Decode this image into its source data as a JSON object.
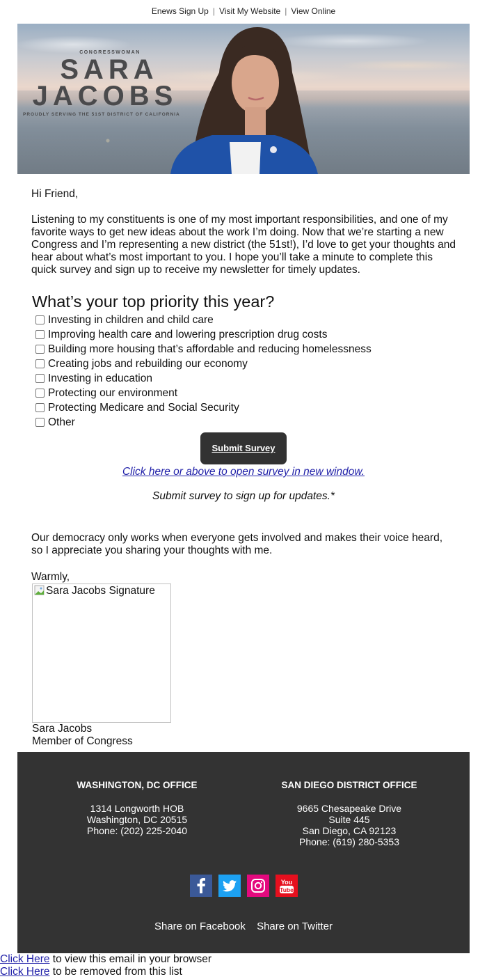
{
  "topnav": {
    "links": [
      "Enews Sign Up",
      "Visit My Website",
      "View Online"
    ],
    "separator": "|"
  },
  "banner": {
    "kicker": "CONGRESSWOMAN",
    "name_line1": "SARA",
    "name_line2": "JACOBS",
    "tagline": "PROUDLY SERVING THE 51ST DISTRICT OF CALIFORNIA"
  },
  "body": {
    "greeting": "Hi Friend,",
    "intro": "Listening to my constituents is one of my most important responsibilities, and one of my favorite ways to get new ideas about the work I’m doing. Now that we’re starting a new Congress and I’m representing a new district (the 51st!), I’d love to get your thoughts and hear about what’s most important to you. I hope you’ll take a minute to complete this quick survey and sign up to receive my newsletter for timely updates."
  },
  "survey": {
    "title": "What’s your top priority this year?",
    "options": [
      {
        "label": "Investing in children and child care",
        "checked": false
      },
      {
        "label": "Improving health care and lowering prescription drug costs",
        "checked": false
      },
      {
        "label": "Building more housing that’s affordable and reducing homelessness",
        "checked": false
      },
      {
        "label": "Creating jobs and rebuilding our economy",
        "checked": false
      },
      {
        "label": "Investing in education",
        "checked": false
      },
      {
        "label": "Protecting our environment",
        "checked": false
      },
      {
        "label": "Protecting Medicare and Social Security",
        "checked": false
      },
      {
        "label": "Other",
        "checked": false
      }
    ],
    "submit_label": "Submit Survey",
    "open_link": "Click here or above to open survey in new window.",
    "note": "Submit survey to sign up for updates.*"
  },
  "closing": {
    "text": "Our democracy only works when everyone gets involved and makes their voice heard, so I appreciate you sharing your thoughts with me.",
    "signoff": "Warmly,",
    "signature_alt": "Sara Jacobs Signature",
    "name": "Sara Jacobs",
    "title": "Member of Congress"
  },
  "footer": {
    "offices": [
      {
        "heading": "WASHINGTON, DC OFFICE",
        "lines": [
          "1314 Longworth HOB",
          "Washington, DC 20515",
          "Phone: (202) 225-2040"
        ]
      },
      {
        "heading": "SAN DIEGO DISTRICT OFFICE",
        "lines": [
          "9665 Chesapeake Drive",
          "Suite 445",
          "San Diego, CA 92123",
          "Phone: (619) 280-5353"
        ]
      }
    ],
    "social": [
      {
        "name": "facebook",
        "icon": "facebook-icon",
        "color": "#3b5998"
      },
      {
        "name": "twitter",
        "icon": "twitter-icon",
        "color": "#1da1f2"
      },
      {
        "name": "instagram",
        "icon": "instagram-icon",
        "color": "#e4097e"
      },
      {
        "name": "youtube",
        "icon": "youtube-icon",
        "color": "#e60f1e"
      }
    ],
    "youtube_text_top": "You",
    "youtube_text_bottom": "Tube",
    "share_facebook": "Share on Facebook",
    "share_twitter": "Share on Twitter",
    "background": "#333333"
  },
  "bottom": {
    "view_link": "Click Here",
    "view_text": " to view this email in your browser",
    "remove_link": "Click Here",
    "remove_text": " to be removed from this list"
  },
  "colors": {
    "link": "#1f1fa8",
    "button": "#323232"
  }
}
